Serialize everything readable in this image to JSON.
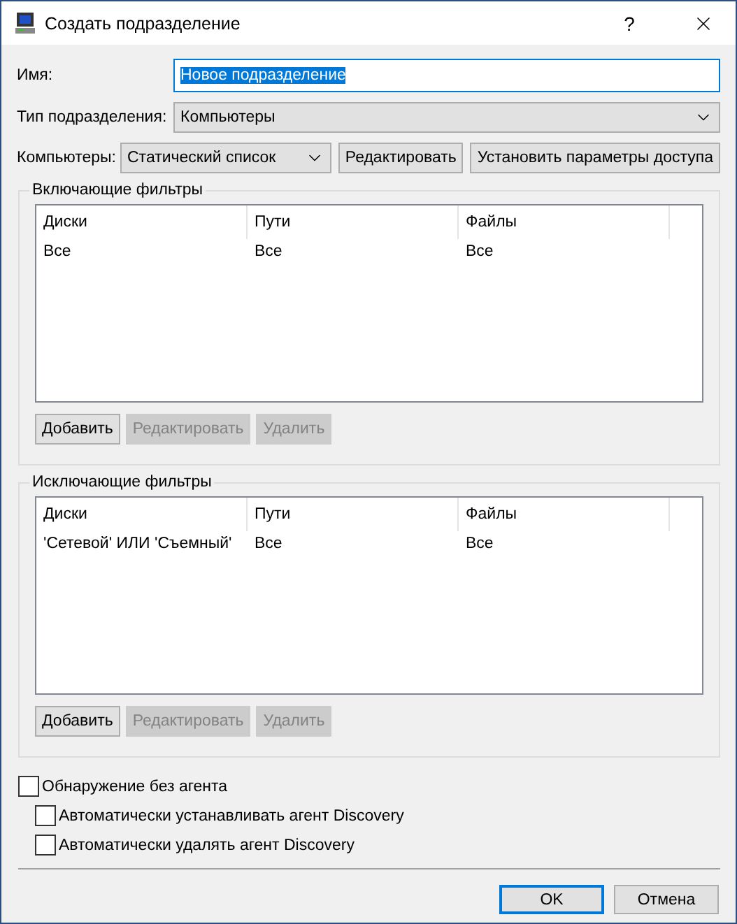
{
  "window": {
    "title": "Создать подразделение",
    "help": "?"
  },
  "name_field": {
    "label": "Имя:",
    "value": "Новое подразделение",
    "text_selected": true
  },
  "type_field": {
    "label": "Тип подразделения:",
    "value": "Компьютеры"
  },
  "computers": {
    "label": "Компьютеры:",
    "value": "Статический список",
    "buttons": [
      {
        "label": "Редактировать",
        "disabled": false
      },
      {
        "label": "Установить параметры доступа",
        "disabled": false
      }
    ]
  },
  "filter_groups": [
    {
      "title": "Включающие фильтры",
      "columns": [
        "Диски",
        "Пути",
        "Файлы"
      ],
      "rows": [
        [
          "Все",
          "Все",
          "Все"
        ]
      ],
      "buttons": [
        {
          "label": "Добавить",
          "disabled": false
        },
        {
          "label": "Редактировать",
          "disabled": true
        },
        {
          "label": "Удалить",
          "disabled": true
        }
      ]
    },
    {
      "title": "Исключающие фильтры",
      "columns": [
        "Диски",
        "Пути",
        "Файлы"
      ],
      "rows": [
        [
          "'Сетевой' ИЛИ 'Съемный'",
          "Все",
          "Все"
        ]
      ],
      "buttons": [
        {
          "label": "Добавить",
          "disabled": false
        },
        {
          "label": "Редактировать",
          "disabled": true
        },
        {
          "label": "Удалить",
          "disabled": true
        }
      ]
    }
  ],
  "options": [
    {
      "label": "Обнаружение без агента",
      "checked": false,
      "children": [
        {
          "label": "Автоматически устанавливать агент Discovery",
          "checked": false
        },
        {
          "label": "Автоматически удалять агент Discovery",
          "checked": false
        }
      ]
    }
  ],
  "dialog_buttons": [
    {
      "label": "OK",
      "default": true
    },
    {
      "label": "Отмена",
      "default": false
    }
  ]
}
